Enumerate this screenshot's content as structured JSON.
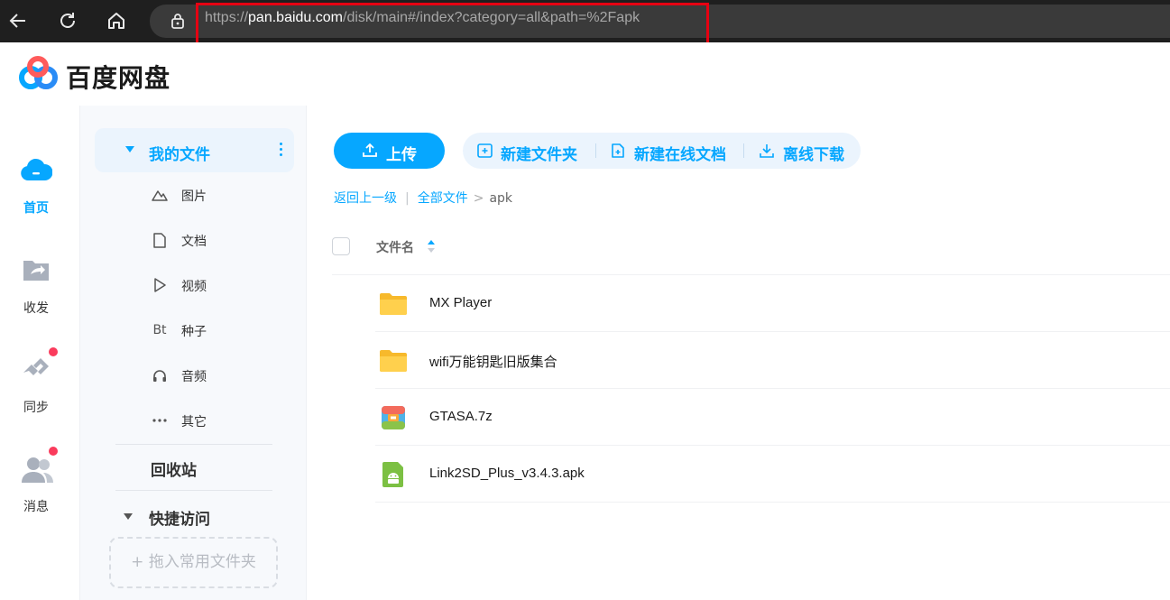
{
  "browser": {
    "url_prefix": "https://",
    "url_host": "pan.baidu.com",
    "url_path": "/disk/main#/index?category=all&path=%2Fapk"
  },
  "app": {
    "logo_text": "百度网盘"
  },
  "rail": [
    {
      "label": "首页",
      "icon": "cloud-home-icon",
      "active": true
    },
    {
      "label": "收发",
      "icon": "share-folder-icon"
    },
    {
      "label": "同步",
      "icon": "sync-icon",
      "badge": true
    },
    {
      "label": "消息",
      "icon": "people-icon",
      "badge": true
    }
  ],
  "sidebar": {
    "my_files": "我的文件",
    "categories": [
      {
        "label": "图片",
        "icon": "image-icon"
      },
      {
        "label": "文档",
        "icon": "document-icon"
      },
      {
        "label": "视频",
        "icon": "play-icon"
      },
      {
        "label": "种子",
        "icon": "bt-icon",
        "glyph": "Bt"
      },
      {
        "label": "音频",
        "icon": "headphones-icon"
      },
      {
        "label": "其它",
        "icon": "more-icon"
      }
    ],
    "recycle": "回收站",
    "quick_access": "快捷访问",
    "add_favorite": "+ 拖入常用文件夹"
  },
  "toolbar": {
    "upload": "上传",
    "new_folder": "新建文件夹",
    "new_online_doc": "新建在线文档",
    "offline_download": "离线下载"
  },
  "breadcrumb": {
    "back": "返回上一级",
    "all_files": "全部文件",
    "current": "apk",
    "arrow": ">"
  },
  "list": {
    "column_name": "文件名",
    "files": [
      {
        "name": "MX Player",
        "type": "folder"
      },
      {
        "name": "wifi万能钥匙旧版集合",
        "type": "folder"
      },
      {
        "name": "GTASA.7z",
        "type": "archive"
      },
      {
        "name": "Link2SD_Plus_v3.4.3.apk",
        "type": "apk"
      }
    ]
  },
  "colors": {
    "accent": "#06a7ff",
    "badge": "#fa3b5c",
    "highlight": "#e60012"
  }
}
